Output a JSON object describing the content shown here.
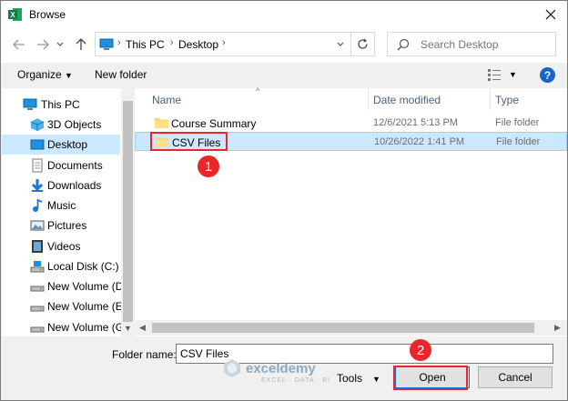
{
  "window": {
    "title": "Browse",
    "app_icon": "excel-icon"
  },
  "nav": {
    "breadcrumb": [
      "This PC",
      "Desktop"
    ],
    "search_placeholder": "Search Desktop"
  },
  "commands": {
    "organize": "Organize",
    "new_folder": "New folder"
  },
  "sidebar": {
    "items": [
      {
        "label": "This PC",
        "icon": "pc-icon"
      },
      {
        "label": "3D Objects",
        "icon": "3d-objects-icon"
      },
      {
        "label": "Desktop",
        "icon": "desktop-icon",
        "selected": true
      },
      {
        "label": "Documents",
        "icon": "documents-icon"
      },
      {
        "label": "Downloads",
        "icon": "downloads-icon"
      },
      {
        "label": "Music",
        "icon": "music-icon"
      },
      {
        "label": "Pictures",
        "icon": "pictures-icon"
      },
      {
        "label": "Videos",
        "icon": "videos-icon"
      },
      {
        "label": "Local Disk (C:)",
        "icon": "drive-icon"
      },
      {
        "label": "New Volume (D:",
        "icon": "drive-icon"
      },
      {
        "label": "New Volume (E:)",
        "icon": "drive-icon"
      },
      {
        "label": "New Volume (G:",
        "icon": "drive-icon"
      }
    ]
  },
  "columns": {
    "name": "Name",
    "date": "Date modified",
    "type": "Type"
  },
  "files": [
    {
      "name": "Course Summary",
      "date": "12/6/2021 5:13 PM",
      "type": "File folder"
    },
    {
      "name": "CSV Files",
      "date": "10/26/2022 1:41 PM",
      "type": "File folder",
      "selected": true
    }
  ],
  "bottom": {
    "folder_name_label": "Folder name:",
    "folder_name_value": "CSV Files",
    "tools": "Tools",
    "open": "Open",
    "cancel": "Cancel"
  },
  "callouts": [
    "1",
    "2"
  ],
  "watermark": {
    "brand": "exceldemy",
    "tagline": "EXCEL · DATA · BI"
  },
  "colors": {
    "selection": "#cce8ff",
    "callout": "#e8262b",
    "accent": "#0078d7"
  }
}
